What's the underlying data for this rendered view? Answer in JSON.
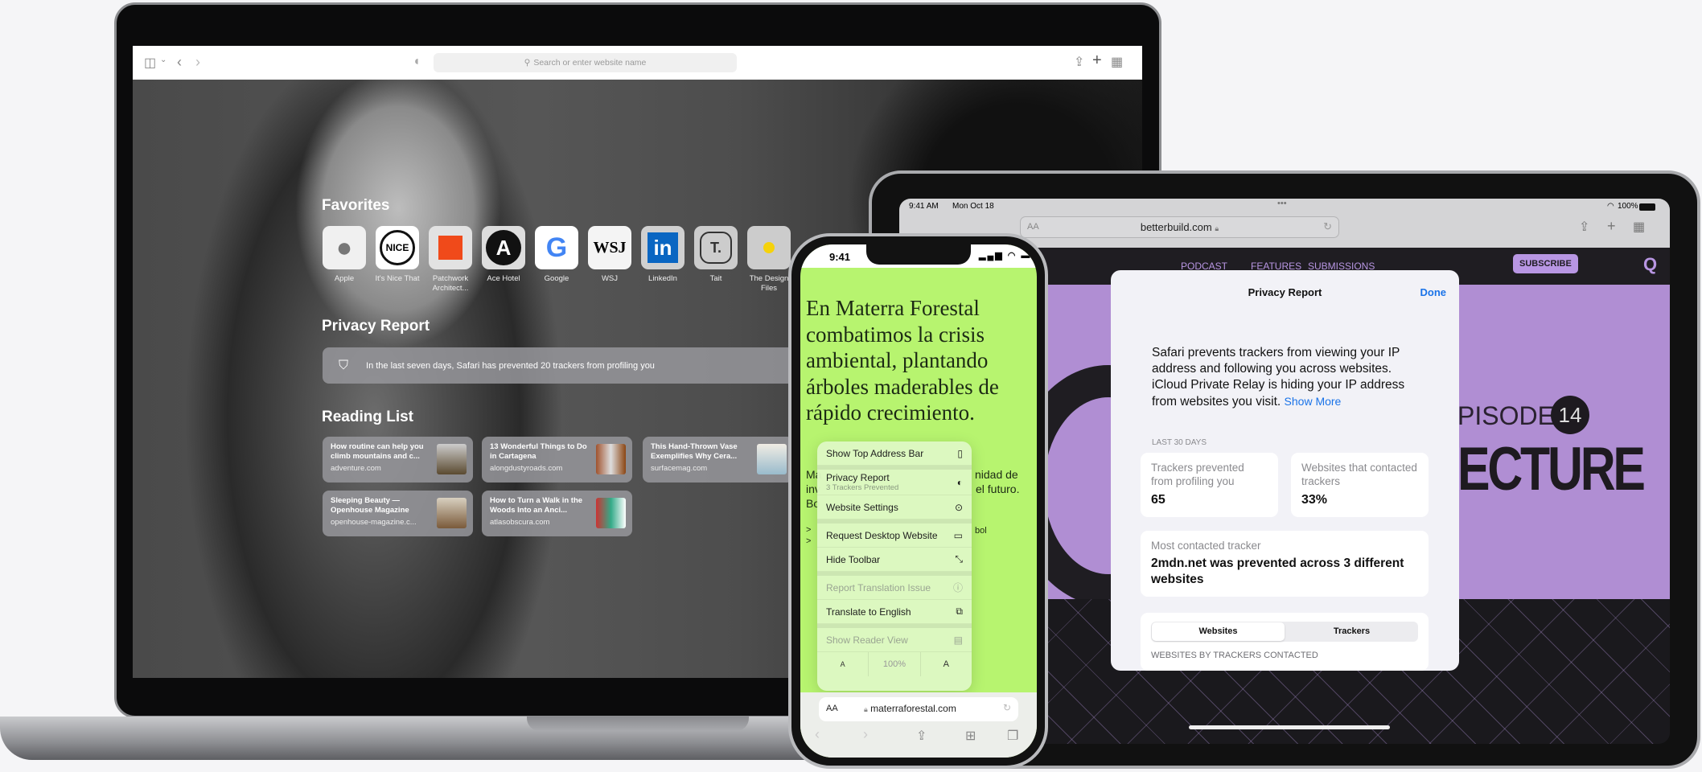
{
  "mac": {
    "toolbar": {
      "search_placeholder": "Search or enter website name",
      "icons": [
        "sidebar-icon",
        "chevron-down-icon",
        "back-icon",
        "forward-icon",
        "shield-icon",
        "search-icon",
        "share-icon",
        "plus-icon",
        "tabs-grid-icon"
      ]
    },
    "favorites_title": "Favorites",
    "favorites": [
      {
        "label": "Apple",
        "icon": "apple-logo"
      },
      {
        "label": "It's Nice That",
        "icon": "nice-logo"
      },
      {
        "label": "Patchwork Architect...",
        "icon": "orange-square-logo"
      },
      {
        "label": "Ace Hotel",
        "icon": "ace-logo",
        "logo_text": "A"
      },
      {
        "label": "Google",
        "icon": "google-logo",
        "logo_text": "G"
      },
      {
        "label": "WSJ",
        "icon": "wsj-logo",
        "logo_text": "WSJ"
      },
      {
        "label": "LinkedIn",
        "icon": "linkedin-logo",
        "logo_text": "in"
      },
      {
        "label": "Tait",
        "icon": "tait-logo",
        "logo_text": "T."
      },
      {
        "label": "The Design Files",
        "icon": "yellow-dot-logo"
      }
    ],
    "privacy_title": "Privacy Report",
    "privacy_text": "In the last seven days, Safari has prevented 20 trackers from profiling you",
    "reading_title": "Reading List",
    "reading": [
      {
        "title": "How routine can help you climb mountains and c...",
        "site": "adventure.com"
      },
      {
        "title": "13 Wonderful Things to Do in Cartagena",
        "site": "alongdustyroads.com"
      },
      {
        "title": "This Hand-Thrown Vase Exemplifies Why Cera...",
        "site": "surfacemag.com"
      },
      {
        "title": "Sleeping Beauty — Openhouse Magazine",
        "site": "openhouse-magazine.c..."
      },
      {
        "title": "How to Turn a Walk in the Woods Into an Anci...",
        "site": "atlasobscura.com"
      }
    ]
  },
  "ipad": {
    "time": "9:41 AM",
    "date": "Mon Oct 18",
    "battery": "100%",
    "text_size_btn": "AA",
    "url": "betterbuild.com",
    "nav": [
      "PODCAST",
      "FEATURES",
      "SUBMISSIONS"
    ],
    "subscribe": "SUBSCRIBE",
    "episode": "PISODE",
    "episode_num": "14",
    "headline": "ECTURE",
    "sheet": {
      "title": "Privacy Report",
      "done": "Done",
      "description": "Safari prevents trackers from viewing your IP address and following you across websites. iCloud Private Relay is hiding your IP address from websites you visit.",
      "show_more": "Show More",
      "period": "LAST 30 DAYS",
      "stat1_label": "Trackers prevented from profiling you",
      "stat1_value": "65",
      "stat2_label": "Websites that contacted trackers",
      "stat2_value": "33%",
      "tracker_label": "Most contacted tracker",
      "tracker_value": "2mdn.net was prevented across 3 different websites",
      "seg": [
        "Websites",
        "Trackers"
      ],
      "list_header": "WEBSITES BY TRACKERS CONTACTED"
    }
  },
  "iphone": {
    "time": "9:41",
    "headline": "En Materra Forestal combatimos la crisis ambiental, plantando árboles maderables de rápido crecimiento.",
    "fragments": {
      "l1": "Ma",
      "r1": "nidad de",
      "l2": "inv",
      "r2": "el futuro.",
      "l3": "Bo",
      "l4": ">",
      "l5": ">",
      "r4": "bol"
    },
    "menu": [
      {
        "label": "Show Top Address Bar",
        "icon": "address-bar-icon",
        "glyph": "▯"
      },
      {
        "label": "Privacy Report",
        "sub": "3 Trackers Prevented",
        "icon": "privacy-shield-icon",
        "glyph": "◐"
      },
      {
        "label": "Website Settings",
        "icon": "website-settings-icon",
        "glyph": "⊙"
      },
      {
        "label": "Request Desktop Website",
        "icon": "desktop-icon",
        "glyph": "▭"
      },
      {
        "label": "Hide Toolbar",
        "icon": "resize-arrows-icon",
        "glyph": "⤡"
      },
      {
        "label": "Report Translation Issue",
        "icon": "info-icon",
        "glyph": "ⓘ",
        "disabled": true
      },
      {
        "label": "Translate to English",
        "icon": "translate-icon",
        "glyph": "⧉"
      },
      {
        "label": "Show Reader View",
        "icon": "reader-icon",
        "glyph": "▤",
        "disabled": true
      }
    ],
    "zoom": {
      "smaller": "A",
      "value": "100%",
      "larger": "A"
    },
    "text_size_btn": "AA",
    "url": "materraforestal.com"
  },
  "colors": {
    "ipad_purple": "#b08ed3",
    "iphone_green": "#b7f46f",
    "link_blue": "#1a73e8"
  }
}
